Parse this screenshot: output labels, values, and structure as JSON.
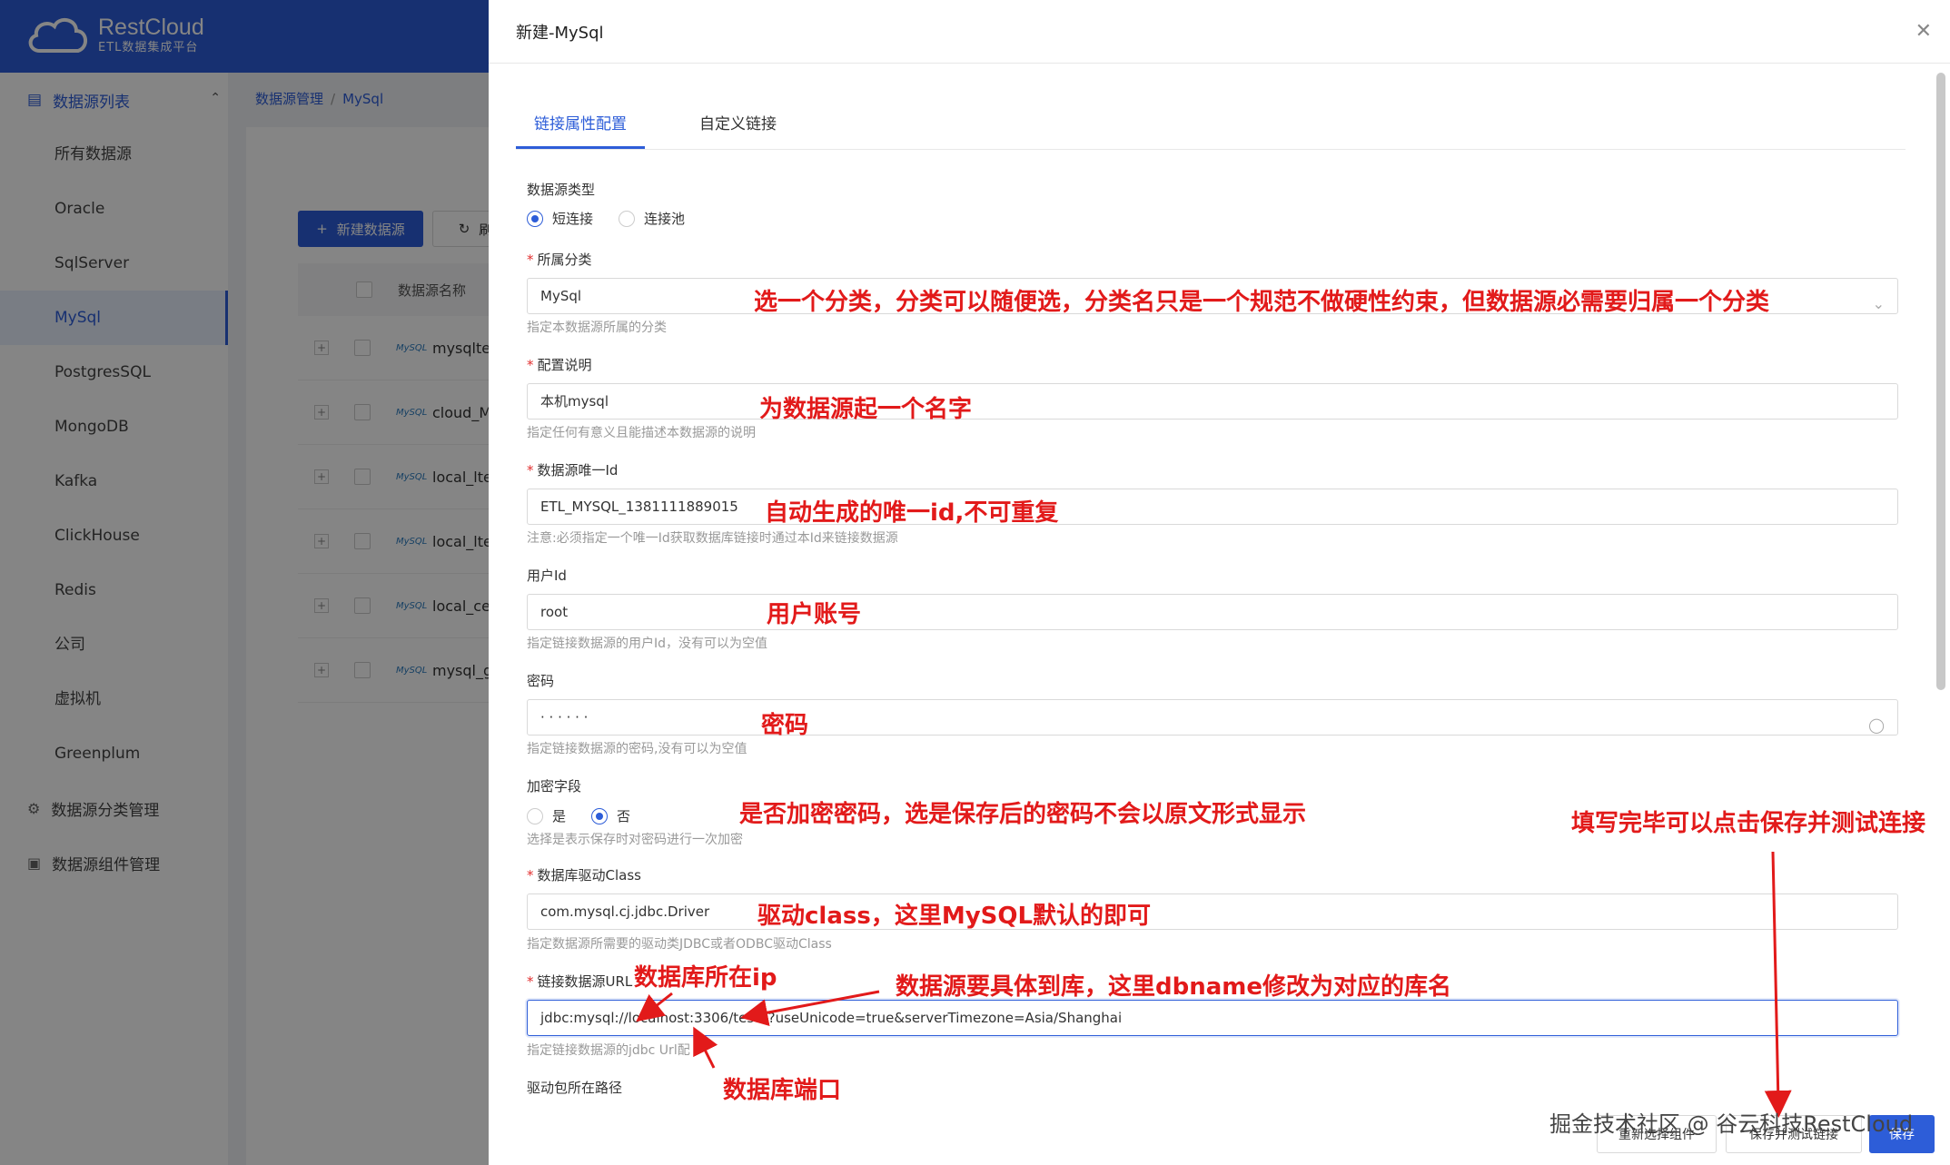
{
  "app": {
    "logo_name": "RestCloud",
    "logo_sub": "ETL数据集成平台"
  },
  "sidebar": {
    "group_label": "数据源列表",
    "items": [
      {
        "label": "所有数据源"
      },
      {
        "label": "Oracle"
      },
      {
        "label": "SqlServer"
      },
      {
        "label": "MySql"
      },
      {
        "label": "PostgresSQL"
      },
      {
        "label": "MongoDB"
      },
      {
        "label": "Kafka"
      },
      {
        "label": "ClickHouse"
      },
      {
        "label": "Redis"
      },
      {
        "label": "公司"
      },
      {
        "label": "虚拟机"
      },
      {
        "label": "Greenplum"
      }
    ],
    "section_category": "数据源分类管理",
    "section_component": "数据源组件管理"
  },
  "breadcrumb": {
    "root": "数据源管理",
    "sep": "/",
    "current": "MySql"
  },
  "toolbar": {
    "new_label": "新建数据源",
    "refresh_label": "刷新"
  },
  "table": {
    "col_name": "数据源名称",
    "rows": [
      {
        "name": "mysqltest"
      },
      {
        "name": "cloud_Mysq"
      },
      {
        "name": "local_ltest"
      },
      {
        "name": "local_ltest(j"
      },
      {
        "name": "local_ceshi"
      },
      {
        "name": "mysql_gs_t"
      }
    ],
    "logo_text": "MySQL"
  },
  "drawer": {
    "title": "新建-MySql",
    "tabs": [
      {
        "label": "链接属性配置"
      },
      {
        "label": "自定义链接"
      }
    ],
    "fields": {
      "type_label": "数据源类型",
      "type_opt1": "短连接",
      "type_opt2": "连接池",
      "category_label": "所属分类",
      "category_value": "MySql",
      "category_help": "指定本数据源所属的分类",
      "desc_label": "配置说明",
      "desc_value": "本机mysql",
      "desc_help": "指定任何有意义且能描述本数据源的说明",
      "id_label": "数据源唯一Id",
      "id_value": "ETL_MYSQL_1381111889015",
      "id_help": "注意:必须指定一个唯一Id获取数据库链接时通过本Id来链接数据源",
      "user_label": "用户Id",
      "user_value": "root",
      "user_help": "指定链接数据源的用户Id，没有可以为空值",
      "pwd_label": "密码",
      "pwd_value": "· · · · · ·",
      "pwd_help": "指定链接数据源的密码,没有可以为空值",
      "encrypt_label": "加密字段",
      "encrypt_yes": "是",
      "encrypt_no": "否",
      "encrypt_help": "选择是表示保存时对密码进行一次加密",
      "driver_label": "数据库驱动Class",
      "driver_value": "com.mysql.cj.jdbc.Driver",
      "driver_help": "指定数据源所需要的驱动类JDBC或者ODBC驱动Class",
      "url_label": "链接数据源URL",
      "url_value": "jdbc:mysql://localhost:3306/test1?useUnicode=true&serverTimezone=Asia/Shanghai",
      "url_help": "指定链接数据源的jdbc Url配",
      "jar_label": "驱动包所在路径"
    },
    "buttons": {
      "reselect": "重新选择组件",
      "save_test": "保存并测试链接",
      "save": "保存"
    }
  },
  "annotations": {
    "category": "选一个分类，分类可以随便选，分类名只是一个规范不做硬性约束，但数据源必需要归属一个分类",
    "desc": "为数据源起一个名字",
    "id": "自动生成的唯一id,不可重复",
    "user": "用户账号",
    "pwd": "密码",
    "encrypt": "是否加密密码，选是保存后的密码不会以原文形式显示",
    "save_hint": "填写完毕可以点击保存并测试连接",
    "driver": "驱动class，这里MySQL默认的即可",
    "ip": "数据库所在ip",
    "dbname": "数据源要具体到库，这里dbname修改为对应的库名",
    "port": "数据库端口"
  },
  "watermark": "掘金技术社区 @ 谷云科技RestCloud",
  "colors": {
    "primary": "#2d5dd8",
    "annotation": "#e21a1a"
  }
}
